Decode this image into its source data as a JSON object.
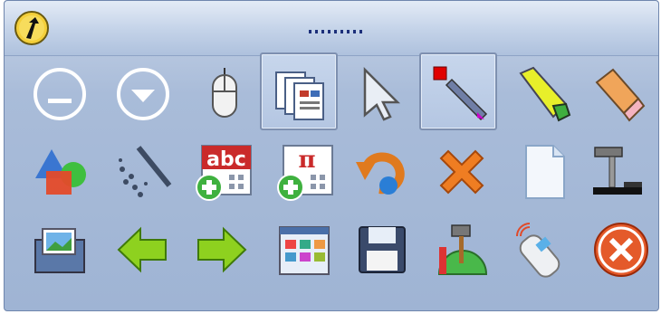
{
  "toolbar": {
    "gripper_label": "........",
    "logo_icon": "up-arrow-logo-icon",
    "tools": [
      {
        "icon": "minus-circle-icon",
        "active": false
      },
      {
        "icon": "down-arrow-circle-icon",
        "active": false
      },
      {
        "icon": "mouse-icon",
        "active": false
      },
      {
        "icon": "pages-icon",
        "active": true
      },
      {
        "icon": "select-arrow-icon",
        "active": false
      },
      {
        "icon": "pen-icon",
        "active": true
      },
      {
        "icon": "highlighter-icon",
        "active": false
      },
      {
        "icon": "eraser-icon",
        "active": false
      },
      {
        "icon": "shapes-icon",
        "active": false
      },
      {
        "icon": "magic-wand-icon",
        "active": false
      },
      {
        "icon": "add-text-icon",
        "active": false,
        "label": "abc"
      },
      {
        "icon": "add-equation-icon",
        "active": false,
        "label": "π"
      },
      {
        "icon": "undo-icon",
        "active": false
      },
      {
        "icon": "delete-icon",
        "active": false
      },
      {
        "icon": "blank-page-icon",
        "active": false
      },
      {
        "icon": "document-camera-icon",
        "active": false
      },
      {
        "icon": "images-icon",
        "active": false
      },
      {
        "icon": "previous-arrow-icon",
        "active": false
      },
      {
        "icon": "next-arrow-icon",
        "active": false
      },
      {
        "icon": "gallery-icon",
        "active": false
      },
      {
        "icon": "save-icon",
        "active": false
      },
      {
        "icon": "tools-icon",
        "active": false
      },
      {
        "icon": "remote-control-icon",
        "active": false
      },
      {
        "icon": "close-icon",
        "active": false
      }
    ]
  }
}
